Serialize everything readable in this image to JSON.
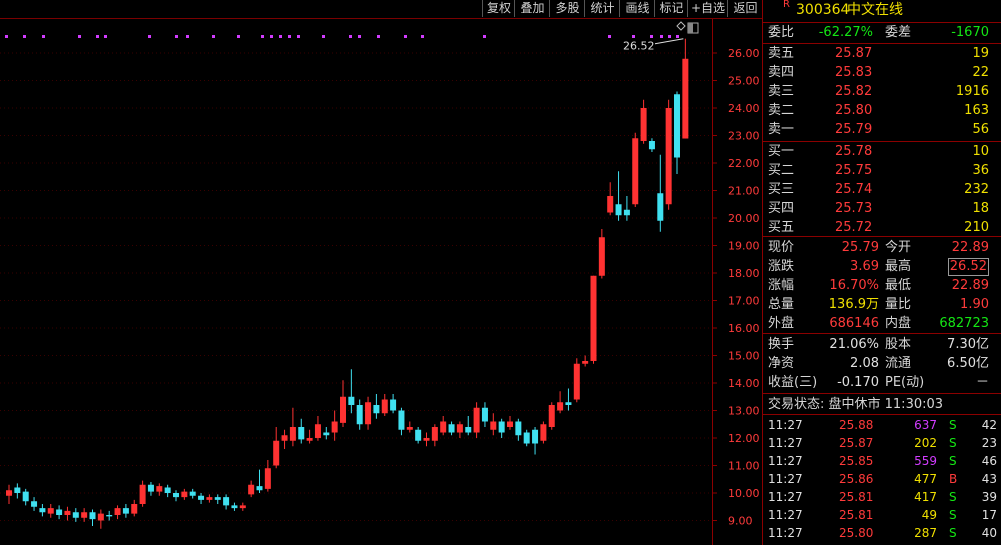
{
  "toolbar": {
    "buttons": [
      "复权",
      "叠加",
      "多股",
      "统计",
      "画线",
      "标记",
      "+自选",
      "返回"
    ]
  },
  "stock": {
    "badge": "R",
    "code": "300364",
    "name": "中文在线"
  },
  "order_ratio": {
    "wb_label": "委比",
    "wb_value": "-62.27%",
    "wc_label": "委差",
    "wc_value": "-1670"
  },
  "asks": [
    {
      "label": "卖五",
      "price": "25.87",
      "vol": "19"
    },
    {
      "label": "卖四",
      "price": "25.83",
      "vol": "22"
    },
    {
      "label": "卖三",
      "price": "25.82",
      "vol": "1916"
    },
    {
      "label": "卖二",
      "price": "25.80",
      "vol": "163"
    },
    {
      "label": "卖一",
      "price": "25.79",
      "vol": "56"
    }
  ],
  "bids": [
    {
      "label": "买一",
      "price": "25.78",
      "vol": "10"
    },
    {
      "label": "买二",
      "price": "25.75",
      "vol": "36"
    },
    {
      "label": "买三",
      "price": "25.74",
      "vol": "232"
    },
    {
      "label": "买四",
      "price": "25.73",
      "vol": "18"
    },
    {
      "label": "买五",
      "price": "25.72",
      "vol": "210"
    }
  ],
  "quote": [
    {
      "l1": "现价",
      "v1": "25.79",
      "c1": "red",
      "l2": "今开",
      "v2": "22.89",
      "c2": "red"
    },
    {
      "l1": "涨跌",
      "v1": "3.69",
      "c1": "red",
      "l2": "最高",
      "v2": "26.52",
      "c2": "red"
    },
    {
      "l1": "涨幅",
      "v1": "16.70%",
      "c1": "red",
      "l2": "最低",
      "v2": "22.89",
      "c2": "red"
    },
    {
      "l1": "总量",
      "v1": "136.9万",
      "c1": "yel",
      "l2": "量比",
      "v2": "1.90",
      "c2": "red"
    },
    {
      "l1": "外盘",
      "v1": "686146",
      "c1": "red",
      "l2": "内盘",
      "v2": "682723",
      "c2": "grn"
    }
  ],
  "fundamentals": [
    {
      "l1": "换手",
      "v1": "21.06%",
      "l2": "股本",
      "v2": "7.30亿"
    },
    {
      "l1": "净资",
      "v1": "2.08",
      "l2": "流通",
      "v2": "6.50亿"
    },
    {
      "l1": "收益(三)",
      "v1": "-0.170",
      "l2": "PE(动)",
      "v2": "－"
    }
  ],
  "trade_status": "交易状态: 盘中休市 11:30:03",
  "ticks": [
    {
      "time": "11:27",
      "price": "25.88",
      "vol": "637",
      "side": "S",
      "n": "42",
      "vcolor": "mag",
      "scolor": "grn"
    },
    {
      "time": "11:27",
      "price": "25.87",
      "vol": "202",
      "side": "S",
      "n": "23",
      "vcolor": "yel",
      "scolor": "grn"
    },
    {
      "time": "11:27",
      "price": "25.85",
      "vol": "559",
      "side": "S",
      "n": "46",
      "vcolor": "mag",
      "scolor": "grn"
    },
    {
      "time": "11:27",
      "price": "25.86",
      "vol": "477",
      "side": "B",
      "n": "43",
      "vcolor": "yel",
      "scolor": "red"
    },
    {
      "time": "11:27",
      "price": "25.81",
      "vol": "417",
      "side": "S",
      "n": "39",
      "vcolor": "yel",
      "scolor": "grn"
    },
    {
      "time": "11:27",
      "price": "25.81",
      "vol": "49",
      "side": "S",
      "n": "17",
      "vcolor": "yel",
      "scolor": "grn"
    },
    {
      "time": "11:27",
      "price": "25.80",
      "vol": "287",
      "side": "S",
      "n": "40",
      "vcolor": "yel",
      "scolor": "grn"
    }
  ],
  "chart_data": {
    "type": "candlestick",
    "y_ticks": [
      "26.00",
      "25.00",
      "24.00",
      "23.00",
      "22.00",
      "21.00",
      "20.00",
      "19.00",
      "18.00",
      "17.00",
      "16.00",
      "15.00",
      "14.00",
      "13.00",
      "12.00",
      "11.00",
      "10.00",
      "9.00"
    ],
    "ylim": [
      8.6,
      27.0
    ],
    "high_marker": "26.52",
    "colors": {
      "up": "#ff3232",
      "down": "#40e0f0",
      "marker": "#d23cff"
    },
    "candles": [
      {
        "o": 9.9,
        "c": 10.1,
        "h": 10.3,
        "l": 9.6
      },
      {
        "o": 10.2,
        "c": 10.0,
        "h": 10.35,
        "l": 9.8
      },
      {
        "o": 10.05,
        "c": 9.7,
        "h": 10.15,
        "l": 9.55
      },
      {
        "o": 9.7,
        "c": 9.5,
        "h": 9.85,
        "l": 9.35
      },
      {
        "o": 9.45,
        "c": 9.3,
        "h": 9.6,
        "l": 9.15
      },
      {
        "o": 9.25,
        "c": 9.45,
        "h": 9.6,
        "l": 9.1
      },
      {
        "o": 9.4,
        "c": 9.2,
        "h": 9.55,
        "l": 9.05
      },
      {
        "o": 9.2,
        "c": 9.35,
        "h": 9.5,
        "l": 9.0
      },
      {
        "o": 9.3,
        "c": 9.1,
        "h": 9.45,
        "l": 8.95
      },
      {
        "o": 9.1,
        "c": 9.3,
        "h": 9.45,
        "l": 8.95
      },
      {
        "o": 9.3,
        "c": 9.05,
        "h": 9.4,
        "l": 8.8
      },
      {
        "o": 9.0,
        "c": 9.25,
        "h": 9.4,
        "l": 8.7
      },
      {
        "o": 9.2,
        "c": 9.15,
        "h": 9.35,
        "l": 9.0
      },
      {
        "o": 9.2,
        "c": 9.45,
        "h": 9.55,
        "l": 9.05
      },
      {
        "o": 9.45,
        "c": 9.25,
        "h": 9.6,
        "l": 9.1
      },
      {
        "o": 9.25,
        "c": 9.6,
        "h": 9.75,
        "l": 9.15
      },
      {
        "o": 9.6,
        "c": 10.3,
        "h": 10.45,
        "l": 9.5
      },
      {
        "o": 10.3,
        "c": 10.05,
        "h": 10.4,
        "l": 9.9
      },
      {
        "o": 10.05,
        "c": 10.25,
        "h": 10.35,
        "l": 9.9
      },
      {
        "o": 10.2,
        "c": 10.0,
        "h": 10.3,
        "l": 9.85
      },
      {
        "o": 10.0,
        "c": 9.85,
        "h": 10.1,
        "l": 9.7
      },
      {
        "o": 9.85,
        "c": 10.05,
        "h": 10.15,
        "l": 9.75
      },
      {
        "o": 10.05,
        "c": 9.9,
        "h": 10.15,
        "l": 9.8
      },
      {
        "o": 9.9,
        "c": 9.75,
        "h": 10.0,
        "l": 9.6
      },
      {
        "o": 9.75,
        "c": 9.85,
        "h": 9.95,
        "l": 9.65
      },
      {
        "o": 9.85,
        "c": 9.75,
        "h": 9.95,
        "l": 9.6
      },
      {
        "o": 9.85,
        "c": 9.55,
        "h": 9.95,
        "l": 9.4
      },
      {
        "o": 9.55,
        "c": 9.45,
        "h": 9.65,
        "l": 9.35
      },
      {
        "o": 9.45,
        "c": 9.55,
        "h": 9.65,
        "l": 9.35
      },
      {
        "o": 9.95,
        "c": 10.3,
        "h": 10.45,
        "l": 9.85
      },
      {
        "o": 10.25,
        "c": 10.1,
        "h": 10.85,
        "l": 10.0
      },
      {
        "o": 10.15,
        "c": 10.9,
        "h": 11.2,
        "l": 10.05
      },
      {
        "o": 11.0,
        "c": 11.9,
        "h": 12.4,
        "l": 10.9
      },
      {
        "o": 11.9,
        "c": 12.1,
        "h": 12.3,
        "l": 11.6
      },
      {
        "o": 11.9,
        "c": 12.4,
        "h": 13.1,
        "l": 11.7
      },
      {
        "o": 12.4,
        "c": 11.95,
        "h": 12.7,
        "l": 11.8
      },
      {
        "o": 11.9,
        "c": 12.0,
        "h": 12.3,
        "l": 11.8
      },
      {
        "o": 12.0,
        "c": 12.5,
        "h": 12.8,
        "l": 11.9
      },
      {
        "o": 12.2,
        "c": 12.1,
        "h": 12.4,
        "l": 11.95
      },
      {
        "o": 12.2,
        "c": 12.6,
        "h": 13.0,
        "l": 11.9
      },
      {
        "o": 12.55,
        "c": 13.5,
        "h": 14.1,
        "l": 12.4
      },
      {
        "o": 13.5,
        "c": 13.2,
        "h": 14.5,
        "l": 12.9
      },
      {
        "o": 13.2,
        "c": 12.5,
        "h": 13.4,
        "l": 12.3
      },
      {
        "o": 12.5,
        "c": 13.3,
        "h": 13.5,
        "l": 12.3
      },
      {
        "o": 13.2,
        "c": 12.9,
        "h": 13.6,
        "l": 12.7
      },
      {
        "o": 12.9,
        "c": 13.4,
        "h": 13.6,
        "l": 12.8
      },
      {
        "o": 13.4,
        "c": 13.0,
        "h": 13.6,
        "l": 12.9
      },
      {
        "o": 13.0,
        "c": 12.3,
        "h": 13.1,
        "l": 12.1
      },
      {
        "o": 12.3,
        "c": 12.4,
        "h": 12.6,
        "l": 12.2
      },
      {
        "o": 12.3,
        "c": 11.9,
        "h": 12.4,
        "l": 11.8
      },
      {
        "o": 11.9,
        "c": 12.0,
        "h": 12.2,
        "l": 11.7
      },
      {
        "o": 11.9,
        "c": 12.4,
        "h": 12.5,
        "l": 11.7
      },
      {
        "o": 12.2,
        "c": 12.6,
        "h": 12.8,
        "l": 12.1
      },
      {
        "o": 12.5,
        "c": 12.2,
        "h": 12.6,
        "l": 12.1
      },
      {
        "o": 12.2,
        "c": 12.5,
        "h": 12.6,
        "l": 12.0
      },
      {
        "o": 12.4,
        "c": 12.2,
        "h": 12.8,
        "l": 12.1
      },
      {
        "o": 12.2,
        "c": 13.1,
        "h": 13.3,
        "l": 12.0
      },
      {
        "o": 13.1,
        "c": 12.6,
        "h": 13.3,
        "l": 12.4
      },
      {
        "o": 12.3,
        "c": 12.6,
        "h": 12.9,
        "l": 12.1
      },
      {
        "o": 12.6,
        "c": 12.2,
        "h": 12.7,
        "l": 12.0
      },
      {
        "o": 12.4,
        "c": 12.6,
        "h": 12.8,
        "l": 12.3
      },
      {
        "o": 12.6,
        "c": 12.1,
        "h": 12.7,
        "l": 11.9
      },
      {
        "o": 12.2,
        "c": 11.8,
        "h": 12.3,
        "l": 11.7
      },
      {
        "o": 12.3,
        "c": 11.8,
        "h": 12.4,
        "l": 11.4
      },
      {
        "o": 11.9,
        "c": 12.5,
        "h": 12.6,
        "l": 11.8
      },
      {
        "o": 12.4,
        "c": 13.2,
        "h": 13.3,
        "l": 12.3
      },
      {
        "o": 13.0,
        "c": 13.3,
        "h": 13.7,
        "l": 12.9
      },
      {
        "o": 13.3,
        "c": 13.2,
        "h": 13.8,
        "l": 13.0
      },
      {
        "o": 13.4,
        "c": 14.7,
        "h": 14.9,
        "l": 13.3
      },
      {
        "o": 14.7,
        "c": 14.8,
        "h": 15.0,
        "l": 14.6
      },
      {
        "o": 14.8,
        "c": 17.9,
        "h": 17.9,
        "l": 14.7
      },
      {
        "o": 17.9,
        "c": 19.3,
        "h": 19.6,
        "l": 17.8
      },
      {
        "o": 20.2,
        "c": 20.8,
        "h": 21.3,
        "l": 20.1
      },
      {
        "o": 20.5,
        "c": 20.1,
        "h": 21.7,
        "l": 19.9
      },
      {
        "o": 20.3,
        "c": 20.1,
        "h": 20.8,
        "l": 19.9
      },
      {
        "o": 20.5,
        "c": 22.9,
        "h": 23.1,
        "l": 20.4
      },
      {
        "o": 22.8,
        "c": 24.0,
        "h": 24.3,
        "l": 22.7
      },
      {
        "o": 22.8,
        "c": 22.5,
        "h": 22.9,
        "l": 22.4
      },
      {
        "o": 20.9,
        "c": 19.9,
        "h": 22.3,
        "l": 19.5
      },
      {
        "o": 20.5,
        "c": 24.0,
        "h": 24.3,
        "l": 20.3
      },
      {
        "o": 24.5,
        "c": 22.2,
        "h": 24.6,
        "l": 21.6
      },
      {
        "o": 22.89,
        "c": 25.79,
        "h": 26.52,
        "l": 22.89
      }
    ]
  }
}
